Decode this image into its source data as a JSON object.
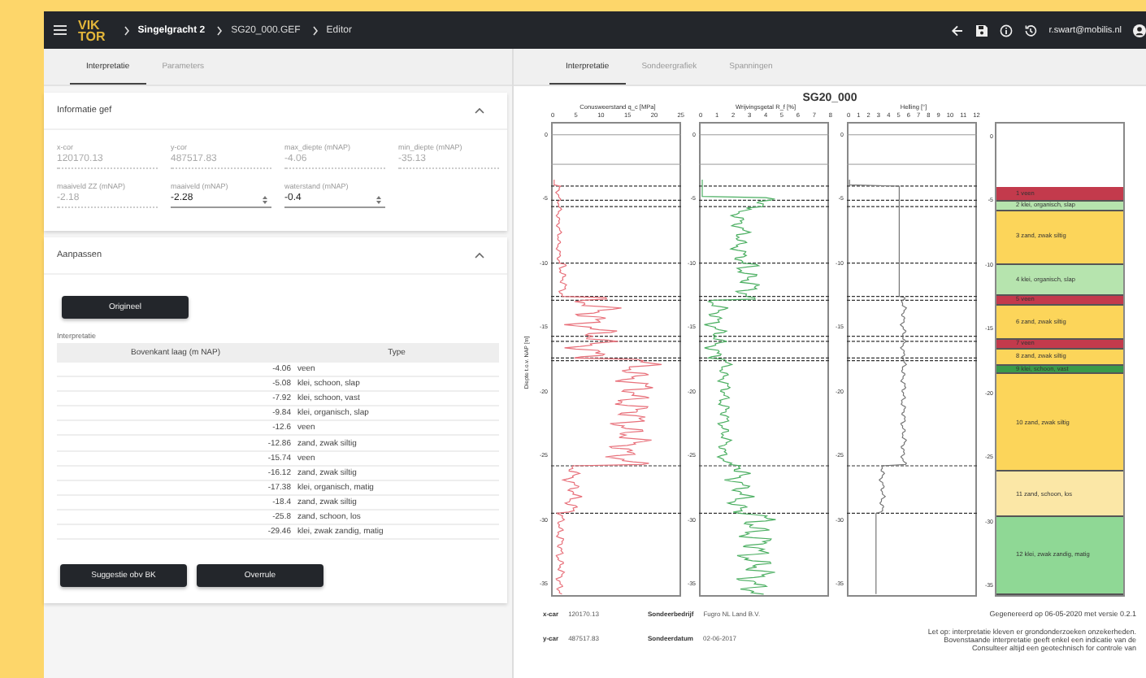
{
  "top_bar": {
    "logo": [
      "VIK",
      "TOR"
    ],
    "breadcrumbs": [
      "Singelgracht 2",
      "SG20_000.GEF",
      "Editor"
    ],
    "user": "r.swart@mobilis.nl"
  },
  "left_tabs": [
    {
      "label": "Interpretatie",
      "selected": true
    },
    {
      "label": "Parameters",
      "selected": false
    }
  ],
  "right_tabs": [
    {
      "label": "Interpretatie",
      "selected": true
    },
    {
      "label": "Sondeergrafiek",
      "selected": false
    },
    {
      "label": "Spanningen",
      "selected": false
    }
  ],
  "info_card": {
    "title": "Informatie gef",
    "expanded": true,
    "fields": [
      {
        "label": "x-cor",
        "value": "120170.13",
        "disabled": true,
        "kind": "text"
      },
      {
        "label": "y-cor",
        "value": "487517.83",
        "disabled": true,
        "kind": "text"
      },
      {
        "label": "max_diepte (mNAP)",
        "value": "-4.06",
        "disabled": true,
        "kind": "text"
      },
      {
        "label": "min_diepte (mNAP)",
        "value": "-35.13",
        "disabled": true,
        "kind": "text"
      },
      {
        "label": "maaiveld ZZ (mNAP)",
        "value": "-2.18",
        "disabled": true,
        "kind": "text"
      },
      {
        "label": "maaiveld (mNAP)",
        "value": "-2.28",
        "disabled": false,
        "kind": "number"
      },
      {
        "label": "waterstand (mNAP)",
        "value": "-0.4",
        "disabled": false,
        "kind": "number"
      }
    ]
  },
  "adjust_card": {
    "title": "Aanpassen",
    "expanded": true,
    "original_button": "Origineel",
    "table_label": "Interpretatie",
    "table": {
      "columns": [
        "Bovenkant laag (m NAP)",
        "Type"
      ],
      "rows": [
        [
          "-4.06",
          "veen"
        ],
        [
          "-5.08",
          "klei, schoon, slap"
        ],
        [
          "-7.92",
          "klei, schoon, vast"
        ],
        [
          "-9.84",
          "klei, organisch, slap"
        ],
        [
          "-12.6",
          "veen"
        ],
        [
          "-12.86",
          "zand, zwak siltig"
        ],
        [
          "-15.74",
          "veen"
        ],
        [
          "-16.12",
          "zand, zwak siltig"
        ],
        [
          "-17.38",
          "klei, organisch, matig"
        ],
        [
          "-18.4",
          "zand, zwak siltig"
        ],
        [
          "-25.8",
          "zand, schoon, los"
        ],
        [
          "-29.46",
          "klei, zwak zandig, matig"
        ]
      ]
    },
    "buttons": [
      "Suggestie obv BK",
      "Overrule"
    ]
  },
  "figure": {
    "title": "SG20_000",
    "ylabel": "Diepte t.o.v. NAP [m]",
    "panels": [
      {
        "title": "Conusweerstand q_c [MPa]",
        "xticks": [
          "0",
          "5",
          "10",
          "15",
          "20",
          "25"
        ],
        "yticks": [
          "0",
          "-5",
          "-10",
          "-15",
          "-20",
          "-25",
          "-30",
          "-35"
        ],
        "kind": "cone"
      },
      {
        "title": "Wrijvingsgetal R_f [%]",
        "xticks": [
          "0",
          "1",
          "2",
          "3",
          "4",
          "5",
          "6",
          "7",
          "8"
        ],
        "yticks": [
          "0",
          "-5",
          "-10",
          "-15",
          "-20",
          "-25",
          "-30",
          "-35"
        ],
        "kind": "friction"
      },
      {
        "title": "Helling [°]",
        "xticks": [
          "0",
          "1",
          "2",
          "3",
          "4",
          "5",
          "6",
          "7",
          "8",
          "9",
          "10",
          "11",
          "12"
        ],
        "yticks": [
          "0",
          "-5",
          "-10",
          "-15",
          "-20",
          "-25",
          "-30",
          "-35"
        ],
        "kind": "incline"
      }
    ],
    "soil_column": {
      "yticks": [
        "0",
        "-5",
        "-10",
        "-15",
        "-20",
        "-25",
        "-30",
        "-35"
      ],
      "layers": [
        {
          "label": "1  veen",
          "color": "#c33a4c"
        },
        {
          "label": "2  klei, organisch, slap",
          "color": "#b6e4ae"
        },
        {
          "label": "3  zand, zwak siltig",
          "color": "#fcd55a"
        },
        {
          "label": "4  klei, organisch, slap",
          "color": "#b6e4ae"
        },
        {
          "label": "5  veen",
          "color": "#c33a4c"
        },
        {
          "label": "6  zand, zwak siltig",
          "color": "#fcd55a"
        },
        {
          "label": "7  veen",
          "color": "#c33a4c"
        },
        {
          "label": "8  zand, zwak siltig",
          "color": "#fcd55a"
        },
        {
          "label": "9  klei, schoon, vast",
          "color": "#3a9a4a"
        },
        {
          "label": "10  zand, zwak siltig",
          "color": "#fcd55a"
        },
        {
          "label": "11  zand, schoon, los",
          "color": "#fbe7a6"
        },
        {
          "label": "12  klei, zwak zandig, matig",
          "color": "#8fd895"
        }
      ]
    },
    "footer": {
      "info": [
        {
          "label": "x-car",
          "value": "120170.13"
        },
        {
          "label": "y-car",
          "value": "487517.83"
        },
        {
          "label": "Sondeerbedrijf",
          "value": "Fugro NL Land B.V."
        },
        {
          "label": "Sondeerdatum",
          "value": "02-06-2017"
        }
      ],
      "generated": "Gegenereerd op 06-05-2020 met versie 0.2.1",
      "disclaimer": [
        "Let op: interpretatie kleven er grondonderzoeken onzekerheden.",
        "Bovenstaande interpretatie geeft enkel een indicatie van de",
        "Consulteer altijd een geotechnisch for controle van"
      ]
    }
  }
}
